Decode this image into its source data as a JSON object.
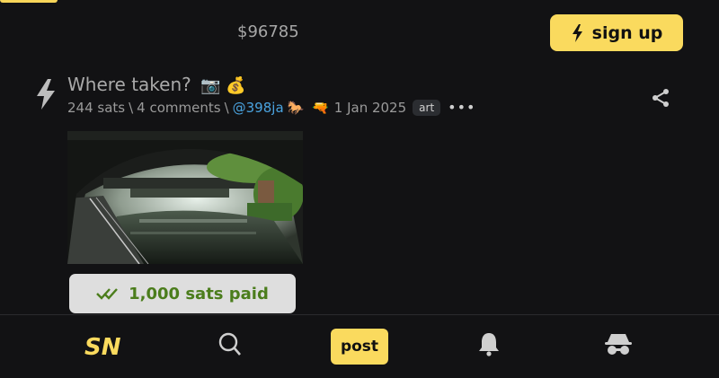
{
  "header": {
    "price": "$96785",
    "signup_label": "sign up"
  },
  "post": {
    "title": "Where taken?",
    "title_emojis": "📷 💰",
    "sats": "244 sats",
    "separator": "\\",
    "comments": "4 comments",
    "user": "@398ja",
    "user_badges": "🐎 🔫",
    "date": "1 Jan 2025",
    "tag": "art",
    "more": "•••",
    "paid_label": "1,000 sats paid"
  },
  "bottom_nav": {
    "logo": "SN",
    "post_label": "post"
  },
  "colors": {
    "accent": "#fada5e",
    "background": "#121214",
    "link": "#4aa3df",
    "paid_text": "#4b7d1c"
  },
  "icons": [
    "lightning-icon",
    "share-icon",
    "double-check-icon",
    "search-icon",
    "bell-icon",
    "anon-icon"
  ]
}
